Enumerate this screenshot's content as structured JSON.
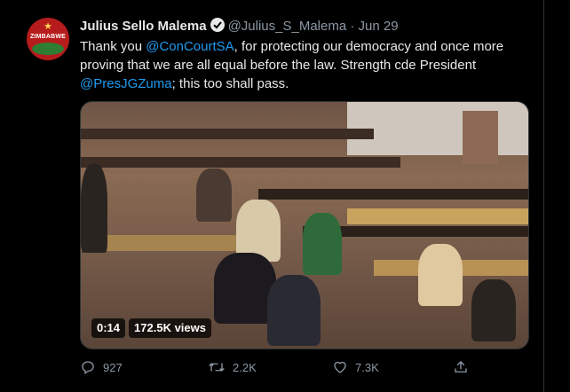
{
  "tweet": {
    "author_name": "Julius Sello Malema",
    "handle": "@Julius_S_Malema",
    "separator": "·",
    "date": "Jun 29",
    "avatar_text": "ZIMBABWE",
    "text_1": "Thank you ",
    "mention_1": "@ConCourtSA",
    "text_2": ", for protecting our democracy and once more proving that we are all equal before the law. Strength cde President ",
    "mention_2": "@PresJGZuma",
    "text_3": "; this too shall pass.",
    "video_time": "0:14",
    "video_views": "172.5K views",
    "replies": "927",
    "retweets": "2.2K",
    "likes": "7.3K"
  },
  "colors": {
    "background": "#000000",
    "text": "#e7e9ea",
    "secondary": "#8b98a5",
    "link": "#1d9bf0"
  },
  "icons": [
    "verified-badge-icon",
    "reply-icon",
    "retweet-icon",
    "like-icon",
    "share-icon"
  ]
}
